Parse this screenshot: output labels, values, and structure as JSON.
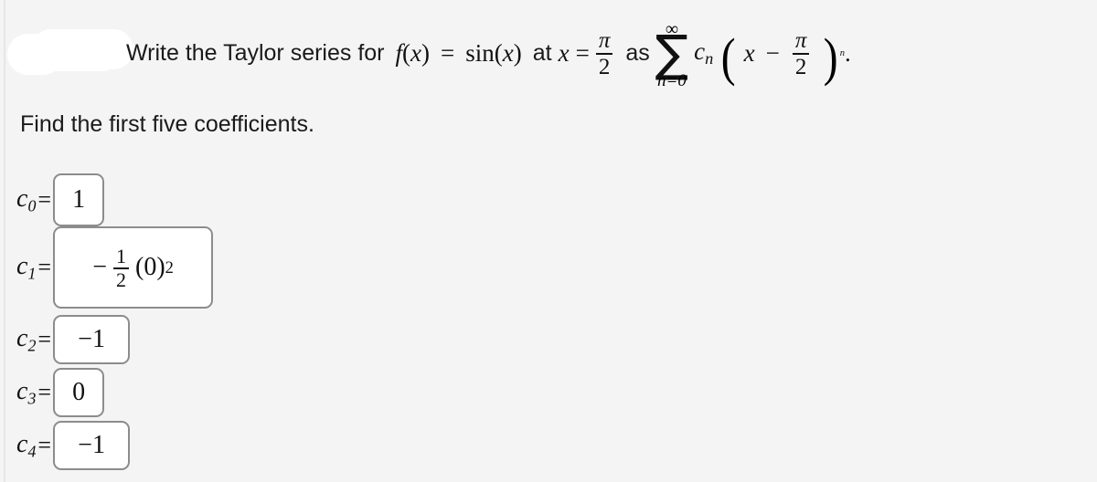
{
  "page": {
    "background_color": "#f4f4f4",
    "redaction_color": "#ffffff"
  },
  "problem": {
    "redaction_label": "redacted-name-blob",
    "prompt_prefix": "Write the Taylor series for",
    "function_lhs": "f",
    "function_arg": "x",
    "equals": "=",
    "function_rhs": "sin",
    "center_phrase": "at",
    "center_variable": "x",
    "center_numerator": "π",
    "center_denominator": "2",
    "connector": "as",
    "sum_upper": "∞",
    "sum_symbol": "∑",
    "sum_lower": "n=0",
    "coefficient_symbol": "c",
    "coefficient_index": "n",
    "series_variable": "x",
    "series_minus": "−",
    "series_numerator": "π",
    "series_denominator": "2",
    "series_exponent": "n",
    "period": ".",
    "instruction": "Find the first five coefficients."
  },
  "coefficients": [
    {
      "label": "c",
      "subscript": "0",
      "equals": "=",
      "value_type": "plain",
      "value": "1"
    },
    {
      "label": "c",
      "subscript": "1",
      "equals": "=",
      "value_type": "fraction_expression",
      "value": "− 1/2 (0)²",
      "sign": "−",
      "frac_numerator": "1",
      "frac_denominator": "2",
      "base": "(0)",
      "exponent": "2"
    },
    {
      "label": "c",
      "subscript": "2",
      "equals": "=",
      "value_type": "plain",
      "value": "−1"
    },
    {
      "label": "c",
      "subscript": "3",
      "equals": "=",
      "value_type": "plain",
      "value": "0"
    },
    {
      "label": "c",
      "subscript": "4",
      "equals": "=",
      "value_type": "plain",
      "value": "−1"
    }
  ]
}
